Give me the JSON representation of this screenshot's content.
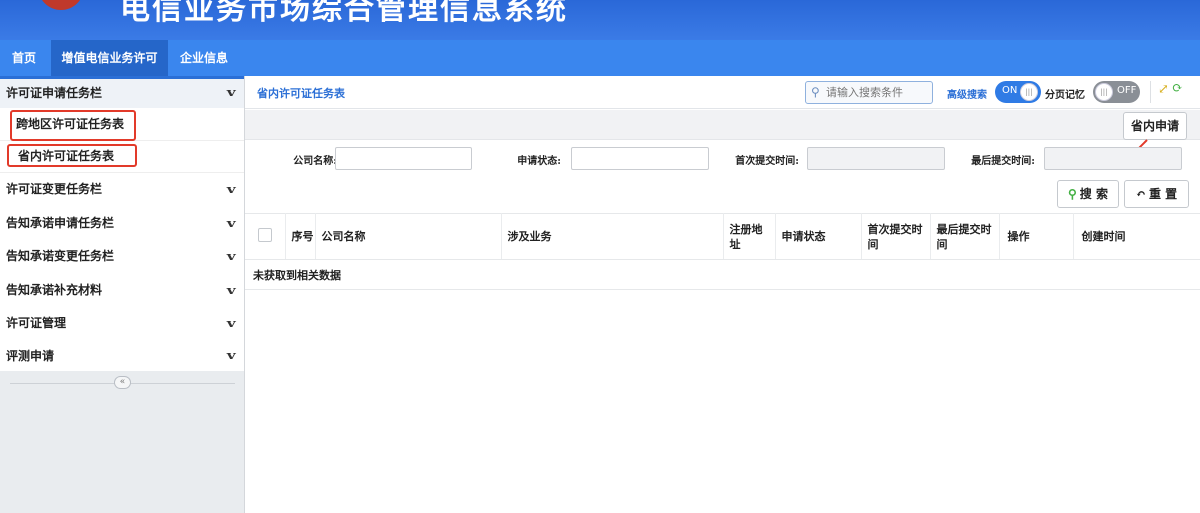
{
  "header": {
    "system_title": "电信业务市场综合管理信息系统"
  },
  "nav": {
    "tabs": [
      {
        "label": "首页"
      },
      {
        "label": "增值电信业务许可"
      },
      {
        "label": "企业信息"
      }
    ]
  },
  "sidebar": {
    "menu_1": {
      "label": "许可证申请任务栏",
      "items": [
        {
          "label": "跨地区许可证任务表"
        },
        {
          "label": "省内许可证任务表"
        }
      ]
    },
    "menus": [
      {
        "label": "许可证变更任务栏"
      },
      {
        "label": "告知承诺申请任务栏"
      },
      {
        "label": "告知承诺变更任务栏"
      },
      {
        "label": "告知承诺补充材料"
      },
      {
        "label": "许可证管理"
      },
      {
        "label": "评测申请"
      }
    ],
    "collapse_icon": "«"
  },
  "main": {
    "tab_title": "省内许可证任务表",
    "search_placeholder": "请输入搜索条件",
    "advanced_search_label": "高级搜索",
    "advanced_toggle": "ON",
    "page_memory_label": "分页记忆",
    "page_memory_toggle": "OFF",
    "apply_button": "省内申请",
    "filters": {
      "company_name": "公司名称:",
      "apply_status": "申请状态:",
      "first_submit": "首次提交时间:",
      "last_submit": "最后提交时间:"
    },
    "search_button": "搜 索",
    "reset_button": "重 置",
    "table": {
      "headers": [
        "序号",
        "公司名称",
        "涉及业务",
        "注册地址",
        "申请状态",
        "首次提交时间",
        "最后提交时间",
        "操作",
        "创建时间"
      ],
      "empty_text": "未获取到相关数据"
    }
  },
  "colors": {
    "primary": "#3a86ee",
    "nav_active": "#2566c9",
    "highlight": "#e23a2a",
    "toggle_on": "#2f7be5",
    "toggle_off": "#8a8f96"
  }
}
